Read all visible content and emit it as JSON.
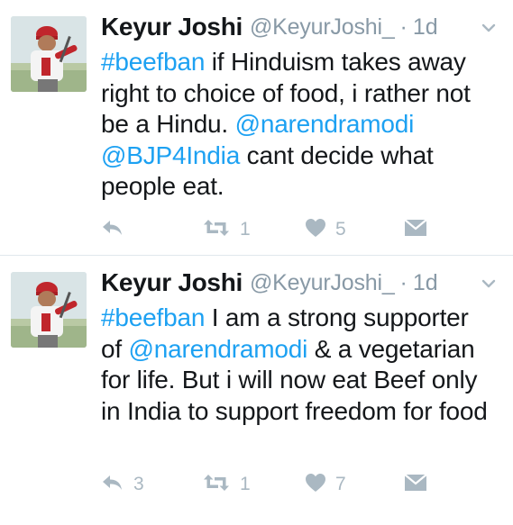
{
  "colors": {
    "link": "#1da1f2",
    "muted": "#8899a6",
    "icon": "#aab8c2",
    "text": "#14171a"
  },
  "tweets": [
    {
      "author": {
        "name": "Keyur Joshi",
        "handle": "@KeyurJoshi_",
        "separator": "·",
        "time": "1d"
      },
      "text": {
        "hashtag": "#beefban",
        "t1": " if Hinduism takes away right to choice of food, i rather not be a Hindu. ",
        "mention1": "@narendramodi",
        "t2": " ",
        "mention2": "@BJP4India",
        "t3": " cant decide what people eat."
      },
      "actions": {
        "reply_count": "",
        "retweet_count": "1",
        "like_count": "5"
      },
      "icons": [
        "reply-icon",
        "retweet-icon",
        "heart-icon",
        "message-icon",
        "chevron-down-icon"
      ]
    },
    {
      "author": {
        "name": "Keyur Joshi",
        "handle": "@KeyurJoshi_",
        "separator": "·",
        "time": "1d"
      },
      "text": {
        "hashtag": "#beefban",
        "t1": " I am a strong supporter of ",
        "mention1": "@narendramodi",
        "t2": " & a vegetarian for life. But i will now eat Beef only in India to support freedom for food"
      },
      "actions": {
        "reply_count": "3",
        "retweet_count": "1",
        "like_count": "7"
      },
      "icons": [
        "reply-icon",
        "retweet-icon",
        "heart-icon",
        "message-icon",
        "chevron-down-icon"
      ]
    }
  ]
}
